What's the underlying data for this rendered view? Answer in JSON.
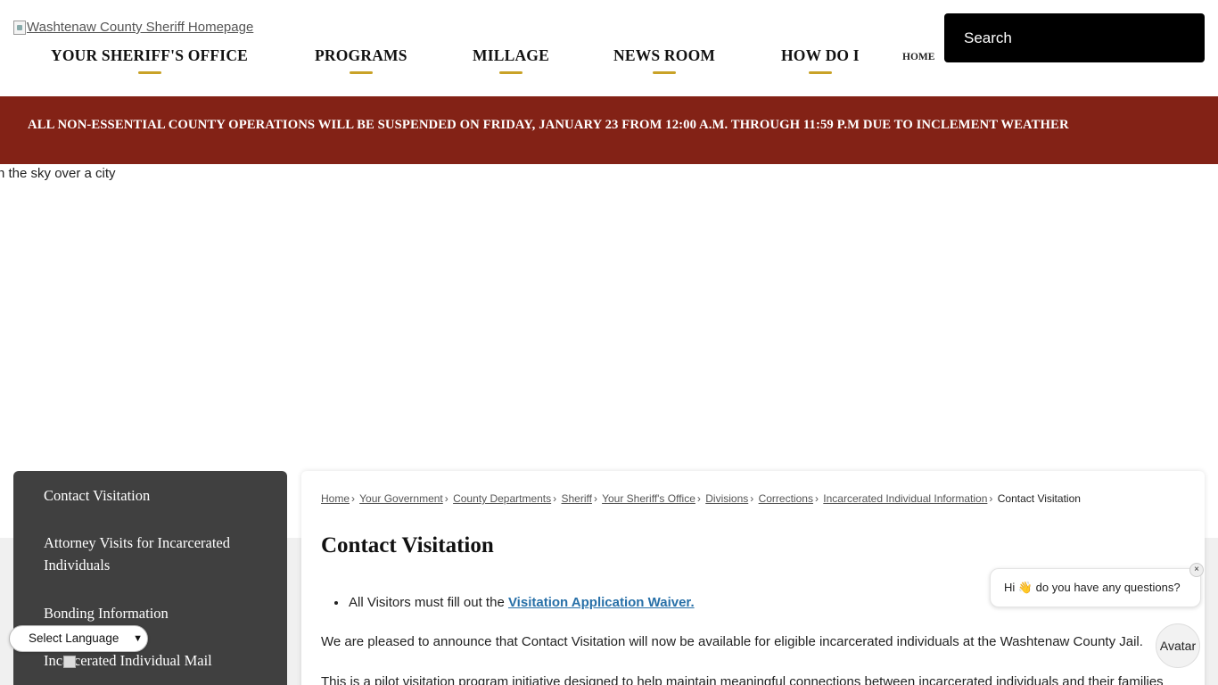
{
  "header": {
    "logo_alt": "Washtenaw County Sheriff Homepage",
    "nav": [
      {
        "label": "YOUR SHERIFF'S OFFICE"
      },
      {
        "label": "PROGRAMS"
      },
      {
        "label": "MILLAGE"
      },
      {
        "label": "NEWS ROOM"
      },
      {
        "label": "HOW DO I"
      }
    ],
    "home_label": "HOME",
    "search_placeholder": "Search"
  },
  "alert": {
    "text": "ALL NON-ESSENTIAL COUNTY OPERATIONS WILL BE SUSPENDED ON FRIDAY, JANUARY 23 FROM 12:00 A.M. THROUGH 11:59 P.M DUE TO INCLEMENT WEATHER"
  },
  "hero": {
    "alt_text": "n the sky over a city"
  },
  "side_nav": {
    "items": [
      {
        "label": "Contact Visitation"
      },
      {
        "label": "Attorney Visits for Incarcerated Individuals"
      },
      {
        "label": "Bonding Information"
      },
      {
        "label": "Incarcerated Individual Mail"
      }
    ]
  },
  "breadcrumb": {
    "items": [
      "Home",
      "Your Government",
      "County Departments",
      "Sheriff",
      "Your Sheriff's Office",
      "Divisions",
      "Corrections",
      "Incarcerated Individual Information"
    ],
    "current": "Contact Visitation"
  },
  "content": {
    "title": "Contact Visitation",
    "bullet_prefix": "All Visitors must fill out the ",
    "bullet_link": "Visitation Application Waiver.",
    "para1": "We are pleased to announce that Contact Visitation will now be available for eligible incarcerated individuals at the Washtenaw County Jail.",
    "para2": "This is a pilot visitation program initiative designed to help maintain meaningful connections between incarcerated individuals and their families"
  },
  "chat": {
    "greeting": "Hi 👋 do you have any questions?",
    "close": "×",
    "avatar_label": "Avatar"
  },
  "language": {
    "selected": "Select Language"
  }
}
